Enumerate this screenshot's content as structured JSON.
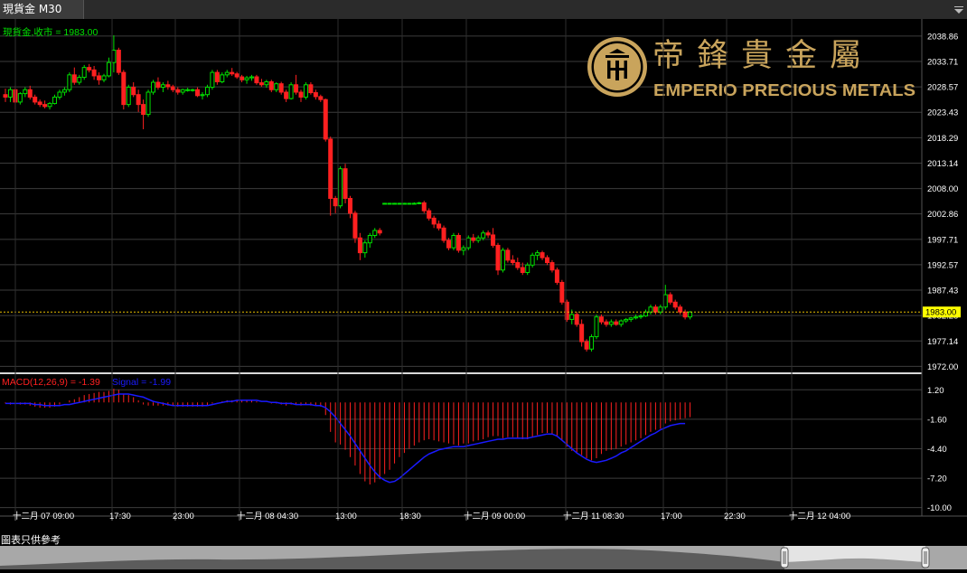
{
  "tab": {
    "title": "現貨金 M30"
  },
  "main_chart": {
    "label": "現貨金,收市 = 1983.00",
    "current_price": "1983.00",
    "y_ticks": [
      "2038.86",
      "2033.71",
      "2028.57",
      "2023.43",
      "2018.29",
      "2013.14",
      "2008.00",
      "2002.86",
      "1997.71",
      "1992.57",
      "1987.43",
      "1982.28",
      "1977.14",
      "1972.00"
    ]
  },
  "macd": {
    "label": "MACD(12,26,9) = -1.39",
    "signal_label": "Signal = -1.99",
    "y_ticks": [
      "1.20",
      "-1.60",
      "-4.40",
      "-7.20",
      "-10.00"
    ]
  },
  "x_axis": {
    "labels": [
      "十二月 07 09:00",
      "17:30",
      "23:00",
      "十二月 08 04:30",
      "13:00",
      "18:30",
      "十二月 09 00:00",
      "十二月 11 08:30",
      "17:00",
      "22:30",
      "十二月 12 04:00"
    ]
  },
  "logo": {
    "chinese_name": "帝鋒貴金屬",
    "english_name": "EMPERIO PRECIOUS METALS"
  },
  "footer": {
    "disclaimer": "圖表只供參考"
  },
  "colors": {
    "up": "#00e000",
    "down": "#ff2020",
    "macd_hist": "#ff2020",
    "signal": "#1a1aff",
    "price_line": "#e8c000",
    "logo_gold": "#c9a45c"
  },
  "chart_data": {
    "type": "candlestick",
    "price_ylim": [
      1970.6,
      2041.4
    ],
    "macd_ylim": [
      -10.8,
      2.6
    ],
    "candles": [
      [
        2027.0,
        2028.2,
        2025.5,
        2026.5
      ],
      [
        2026.5,
        2028.5,
        2025.5,
        2028.0
      ],
      [
        2028.0,
        2028.8,
        2024.0,
        2025.5
      ],
      [
        2025.5,
        2027.5,
        2025.0,
        2027.2
      ],
      [
        2027.2,
        2028.5,
        2026.5,
        2028.0
      ],
      [
        2028.0,
        2028.8,
        2026.0,
        2026.5
      ],
      [
        2026.5,
        2027.0,
        2025.0,
        2025.5
      ],
      [
        2025.5,
        2026.0,
        2024.5,
        2025.0
      ],
      [
        2025.0,
        2025.8,
        2024.2,
        2024.6
      ],
      [
        2024.6,
        2025.5,
        2024.0,
        2025.2
      ],
      [
        2025.2,
        2027.0,
        2025.0,
        2026.5
      ],
      [
        2026.5,
        2028.0,
        2026.0,
        2027.5
      ],
      [
        2027.5,
        2028.5,
        2026.8,
        2028.0
      ],
      [
        2028.0,
        2031.5,
        2027.5,
        2031.0
      ],
      [
        2031.0,
        2032.5,
        2029.0,
        2029.5
      ],
      [
        2029.5,
        2031.0,
        2029.0,
        2030.5
      ],
      [
        2030.5,
        2033.0,
        2030.0,
        2032.5
      ],
      [
        2032.5,
        2033.2,
        2031.5,
        2032.0
      ],
      [
        2032.0,
        2032.8,
        2030.0,
        2030.8
      ],
      [
        2030.8,
        2031.5,
        2029.0,
        2030.0
      ],
      [
        2030.0,
        2031.2,
        2029.5,
        2030.8
      ],
      [
        2030.8,
        2034.5,
        2030.5,
        2033.5
      ],
      [
        2033.5,
        2039.0,
        2031.5,
        2036.0
      ],
      [
        2036.0,
        2036.5,
        2031.0,
        2031.5
      ],
      [
        2031.5,
        2032.0,
        2024.0,
        2025.0
      ],
      [
        2025.0,
        2029.0,
        2024.5,
        2028.5
      ],
      [
        2028.5,
        2029.5,
        2026.5,
        2027.0
      ],
      [
        2027.0,
        2028.0,
        2023.5,
        2025.0
      ],
      [
        2025.0,
        2026.0,
        2020.0,
        2023.0
      ],
      [
        2023.0,
        2028.0,
        2022.5,
        2027.5
      ],
      [
        2027.5,
        2030.0,
        2027.0,
        2029.5
      ],
      [
        2029.5,
        2030.5,
        2028.0,
        2028.5
      ],
      [
        2028.5,
        2029.5,
        2027.5,
        2029.0
      ],
      [
        2029.0,
        2029.8,
        2028.0,
        2028.6
      ],
      [
        2028.6,
        2029.0,
        2027.5,
        2028.0
      ],
      [
        2028.0,
        2028.5,
        2027.0,
        2027.5
      ],
      [
        2027.5,
        2028.2,
        2027.0,
        2028.0
      ],
      [
        2028.0,
        2028.4,
        2027.6,
        2028.0
      ],
      [
        2028.0,
        2028.2,
        2027.6,
        2028.0
      ],
      [
        2028.0,
        2028.5,
        2026.5,
        2026.8
      ],
      [
        2026.8,
        2027.5,
        2026.0,
        2027.0
      ],
      [
        2027.0,
        2029.0,
        2026.5,
        2028.5
      ],
      [
        2028.5,
        2032.0,
        2028.0,
        2031.5
      ],
      [
        2031.5,
        2032.0,
        2029.0,
        2029.6
      ],
      [
        2029.6,
        2031.5,
        2029.3,
        2031.0
      ],
      [
        2031.0,
        2032.0,
        2030.5,
        2031.5
      ],
      [
        2031.5,
        2032.4,
        2030.8,
        2031.2
      ],
      [
        2031.2,
        2031.6,
        2030.2,
        2030.6
      ],
      [
        2030.6,
        2031.0,
        2029.5,
        2030.0
      ],
      [
        2030.0,
        2030.8,
        2029.2,
        2030.4
      ],
      [
        2030.4,
        2031.0,
        2029.8,
        2030.6
      ],
      [
        2030.6,
        2031.0,
        2029.0,
        2029.4
      ],
      [
        2029.4,
        2030.2,
        2028.6,
        2029.0
      ],
      [
        2029.0,
        2030.0,
        2028.4,
        2029.6
      ],
      [
        2029.6,
        2030.0,
        2027.5,
        2028.0
      ],
      [
        2028.0,
        2029.5,
        2027.5,
        2029.2
      ],
      [
        2029.2,
        2029.6,
        2027.0,
        2027.5
      ],
      [
        2027.5,
        2028.0,
        2025.5,
        2026.2
      ],
      [
        2026.2,
        2029.5,
        2026.0,
        2029.0
      ],
      [
        2029.0,
        2031.0,
        2027.0,
        2027.5
      ],
      [
        2027.5,
        2028.0,
        2025.5,
        2026.5
      ],
      [
        2026.5,
        2029.5,
        2026.0,
        2029.0
      ],
      [
        2029.0,
        2029.5,
        2027.0,
        2027.4
      ],
      [
        2027.4,
        2028.0,
        2026.0,
        2026.6
      ],
      [
        2026.6,
        2027.0,
        2025.5,
        2026.0
      ],
      [
        2026.0,
        2026.2,
        2017.5,
        2018.0
      ],
      [
        2018.0,
        2018.5,
        2002.5,
        2006.0
      ],
      [
        2006.0,
        2006.5,
        2003.0,
        2004.5
      ],
      [
        2004.5,
        2012.5,
        2004.0,
        2012.0
      ],
      [
        2012.0,
        2013.0,
        2005.0,
        2006.0
      ],
      [
        2006.0,
        2006.5,
        2002.0,
        2003.0
      ],
      [
        2003.0,
        2003.5,
        1997.0,
        1998.0
      ],
      [
        1998.0,
        1999.0,
        1993.5,
        1995.0
      ],
      [
        1995.0,
        1997.5,
        1994.0,
        1997.0
      ],
      [
        1997.0,
        1999.0,
        1996.0,
        1998.5
      ],
      [
        1998.5,
        2000.0,
        1998.0,
        1999.5
      ],
      [
        1999.5,
        2000.0,
        1998.5,
        1999.0
      ],
      [
        2005.0,
        2005.1,
        2004.9,
        2005.0
      ],
      [
        2005.0,
        2005.1,
        2004.9,
        2005.0
      ],
      [
        2005.0,
        2005.1,
        2004.9,
        2005.0
      ],
      [
        2005.0,
        2005.1,
        2004.9,
        2005.0
      ],
      [
        2005.0,
        2005.1,
        2004.9,
        2005.0
      ],
      [
        2005.0,
        2005.1,
        2004.9,
        2005.0
      ],
      [
        2005.0,
        2005.2,
        2004.8,
        2005.0
      ],
      [
        2005.0,
        2005.3,
        2004.8,
        2005.1
      ],
      [
        2005.1,
        2005.5,
        2003.0,
        2003.5
      ],
      [
        2003.5,
        2004.0,
        2001.5,
        2002.0
      ],
      [
        2002.0,
        2002.5,
        2000.0,
        2000.8
      ],
      [
        2000.8,
        2001.5,
        1999.5,
        2000.0
      ],
      [
        2000.0,
        2000.5,
        1997.0,
        1997.5
      ],
      [
        1997.5,
        1998.0,
        1995.5,
        1996.0
      ],
      [
        1996.0,
        1999.0,
        1995.5,
        1998.5
      ],
      [
        1998.5,
        1999.0,
        1995.0,
        1995.5
      ],
      [
        1995.5,
        1996.5,
        1994.5,
        1996.0
      ],
      [
        1996.0,
        1998.5,
        1995.5,
        1998.0
      ],
      [
        1998.0,
        1998.8,
        1997.0,
        1997.5
      ],
      [
        1997.5,
        1998.5,
        1997.0,
        1998.0
      ],
      [
        1998.0,
        1999.5,
        1997.5,
        1999.0
      ],
      [
        1999.0,
        1999.5,
        1998.0,
        1998.6
      ],
      [
        1998.6,
        2000.0,
        1996.0,
        1996.5
      ],
      [
        1996.5,
        1997.0,
        1990.5,
        1991.5
      ],
      [
        1991.5,
        1996.0,
        1991.0,
        1995.5
      ],
      [
        1995.5,
        1996.0,
        1993.0,
        1993.5
      ],
      [
        1993.5,
        1994.5,
        1992.5,
        1993.0
      ],
      [
        1993.0,
        1994.0,
        1991.5,
        1992.0
      ],
      [
        1992.0,
        1993.0,
        1990.5,
        1991.0
      ],
      [
        1991.0,
        1993.0,
        1990.5,
        1992.5
      ],
      [
        1992.5,
        1995.0,
        1992.0,
        1994.5
      ],
      [
        1994.5,
        1995.5,
        1993.5,
        1995.0
      ],
      [
        1995.0,
        1995.4,
        1993.5,
        1994.0
      ],
      [
        1994.0,
        1994.5,
        1992.5,
        1993.0
      ],
      [
        1993.0,
        1993.5,
        1991.0,
        1991.5
      ],
      [
        1991.5,
        1992.0,
        1988.5,
        1989.0
      ],
      [
        1989.0,
        1989.5,
        1984.5,
        1985.0
      ],
      [
        1985.0,
        1985.5,
        1981.0,
        1981.5
      ],
      [
        1981.5,
        1983.5,
        1980.5,
        1982.5
      ],
      [
        1982.5,
        1983.0,
        1980.0,
        1980.5
      ],
      [
        1980.5,
        1981.5,
        1976.0,
        1977.0
      ],
      [
        1977.0,
        1977.5,
        1975.0,
        1975.5
      ],
      [
        1975.5,
        1978.5,
        1975.0,
        1978.0
      ],
      [
        1978.0,
        1982.5,
        1977.5,
        1982.0
      ],
      [
        1982.0,
        1982.5,
        1980.5,
        1981.0
      ],
      [
        1981.0,
        1981.5,
        1980.0,
        1980.5
      ],
      [
        1980.5,
        1981.5,
        1980.0,
        1981.0
      ],
      [
        1981.0,
        1981.5,
        1980.2,
        1980.5
      ],
      [
        1980.5,
        1981.5,
        1980.0,
        1981.2
      ],
      [
        1981.2,
        1981.8,
        1980.8,
        1981.5
      ],
      [
        1981.5,
        1982.0,
        1981.0,
        1981.8
      ],
      [
        1981.8,
        1982.5,
        1981.5,
        1982.0
      ],
      [
        1982.0,
        1982.6,
        1981.6,
        1982.2
      ],
      [
        1982.2,
        1983.5,
        1982.0,
        1983.0
      ],
      [
        1983.0,
        1984.5,
        1982.5,
        1984.0
      ],
      [
        1984.0,
        1984.5,
        1982.5,
        1983.0
      ],
      [
        1983.0,
        1984.5,
        1982.5,
        1984.0
      ],
      [
        1984.0,
        1988.5,
        1983.5,
        1986.5
      ],
      [
        1986.5,
        1987.0,
        1984.5,
        1985.0
      ],
      [
        1985.0,
        1985.5,
        1983.5,
        1984.0
      ],
      [
        1984.0,
        1984.5,
        1982.5,
        1983.0
      ],
      [
        1983.0,
        1983.5,
        1981.5,
        1982.0
      ],
      [
        1982.0,
        1983.2,
        1981.5,
        1983.0
      ]
    ],
    "macd_series": [
      -0.1,
      -0.2,
      -0.2,
      -0.2,
      -0.2,
      -0.3,
      -0.4,
      -0.5,
      -0.5,
      -0.5,
      -0.4,
      -0.2,
      0.0,
      0.2,
      0.3,
      0.5,
      0.7,
      0.8,
      0.9,
      1.0,
      1.0,
      1.1,
      1.3,
      1.2,
      0.8,
      0.7,
      0.5,
      0.2,
      -0.2,
      -0.3,
      -0.3,
      -0.3,
      -0.3,
      -0.3,
      -0.3,
      -0.4,
      -0.4,
      -0.4,
      -0.4,
      -0.4,
      -0.4,
      -0.3,
      -0.1,
      0.0,
      0.1,
      0.2,
      0.2,
      0.2,
      0.2,
      0.2,
      0.2,
      0.1,
      0.0,
      0.0,
      -0.1,
      -0.1,
      -0.2,
      -0.3,
      -0.2,
      -0.2,
      -0.3,
      -0.2,
      -0.3,
      -0.3,
      -0.4,
      -1.2,
      -2.8,
      -3.8,
      -4.0,
      -4.5,
      -5.2,
      -6.0,
      -6.8,
      -7.5,
      -7.8,
      -7.6,
      -7.3,
      -6.8,
      -6.4,
      -5.8,
      -5.2,
      -4.8,
      -4.4,
      -4.1,
      -3.8,
      -3.6,
      -3.5,
      -3.6,
      -3.7,
      -3.8,
      -3.9,
      -4.0,
      -4.1,
      -3.9,
      -3.9,
      -3.7,
      -3.6,
      -3.5,
      -3.3,
      -3.2,
      -3.2,
      -3.4,
      -3.3,
      -3.3,
      -3.4,
      -3.5,
      -3.5,
      -3.3,
      -3.1,
      -2.9,
      -2.9,
      -3.0,
      -3.2,
      -3.6,
      -4.2,
      -4.6,
      -4.8,
      -5.0,
      -5.3,
      -5.5,
      -5.3,
      -4.9,
      -4.6,
      -4.5,
      -4.4,
      -4.2,
      -4.0,
      -3.8,
      -3.6,
      -3.4,
      -3.1,
      -2.8,
      -2.6,
      -2.5,
      -2.0,
      -1.8,
      -1.7,
      -1.6,
      -1.5,
      -1.4
    ],
    "signal_series": [
      -0.1,
      -0.1,
      -0.1,
      -0.1,
      -0.1,
      -0.1,
      -0.2,
      -0.2,
      -0.3,
      -0.3,
      -0.3,
      -0.3,
      -0.2,
      -0.2,
      -0.1,
      0.0,
      0.1,
      0.2,
      0.3,
      0.4,
      0.5,
      0.6,
      0.7,
      0.8,
      0.8,
      0.8,
      0.7,
      0.6,
      0.5,
      0.3,
      0.1,
      0.0,
      -0.1,
      -0.2,
      -0.3,
      -0.3,
      -0.3,
      -0.3,
      -0.3,
      -0.3,
      -0.3,
      -0.3,
      -0.2,
      -0.1,
      0.0,
      0.1,
      0.1,
      0.2,
      0.2,
      0.2,
      0.2,
      0.2,
      0.1,
      0.1,
      0.0,
      0.0,
      -0.1,
      -0.1,
      -0.1,
      -0.2,
      -0.2,
      -0.2,
      -0.2,
      -0.3,
      -0.3,
      -0.5,
      -0.9,
      -1.4,
      -2.0,
      -2.6,
      -3.2,
      -3.9,
      -4.6,
      -5.3,
      -6.0,
      -6.6,
      -7.1,
      -7.4,
      -7.6,
      -7.5,
      -7.2,
      -6.8,
      -6.4,
      -6.0,
      -5.6,
      -5.2,
      -4.9,
      -4.7,
      -4.5,
      -4.4,
      -4.3,
      -4.2,
      -4.2,
      -4.2,
      -4.1,
      -4.0,
      -3.9,
      -3.8,
      -3.7,
      -3.6,
      -3.5,
      -3.5,
      -3.4,
      -3.4,
      -3.4,
      -3.4,
      -3.4,
      -3.3,
      -3.2,
      -3.1,
      -3.0,
      -3.0,
      -3.2,
      -3.6,
      -4.0,
      -4.4,
      -4.8,
      -5.1,
      -5.4,
      -5.6,
      -5.7,
      -5.6,
      -5.5,
      -5.3,
      -5.1,
      -4.8,
      -4.6,
      -4.3,
      -4.0,
      -3.7,
      -3.4,
      -3.1,
      -2.9,
      -2.6,
      -2.4,
      -2.2,
      -2.1,
      -2.0,
      -2.0
    ]
  }
}
